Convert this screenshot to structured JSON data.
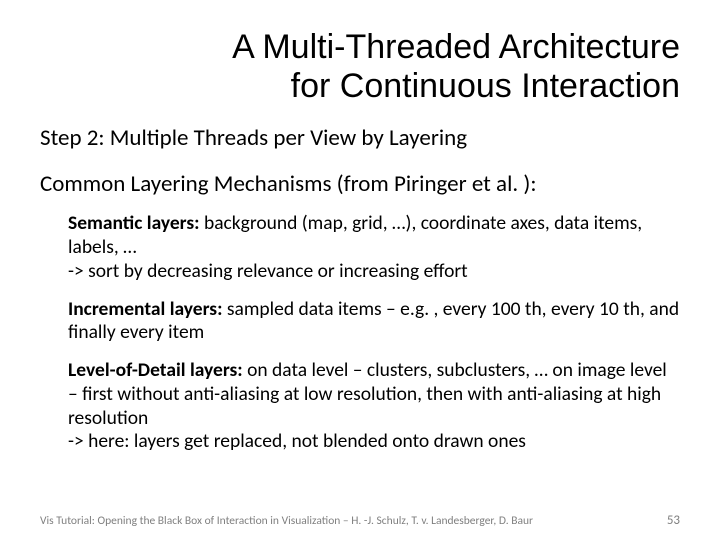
{
  "title_line1": "A Multi-Threaded Architecture",
  "title_line2": "for Continuous Interaction",
  "step": "Step 2: Multiple Threads per View by Layering",
  "subhead": "Common Layering Mechanisms (from Piringer et al. ):",
  "blocks": {
    "semantic": {
      "lead": "Semantic layers:",
      "rest": " background (map, grid, …), coordinate axes, data items, labels, …",
      "tail": "-> sort by decreasing relevance or increasing effort"
    },
    "incremental": {
      "lead": "Incremental layers:",
      "rest": " sampled data items – e.g. , every 100 th, every 10 th, and finally every item"
    },
    "lod": {
      "lead": "Level-of-Detail layers:",
      "rest": " on data level – clusters, subclusters, … on image level – first without anti-aliasing at low resolution, then with anti-aliasing at high resolution",
      "tail": "-> here: layers get replaced, not blended onto drawn ones"
    }
  },
  "footer_text": "Vis Tutorial: Opening the Black Box of Interaction in Visualization – H. -J. Schulz, T. v. Landesberger, D. Baur",
  "page_number": "53"
}
